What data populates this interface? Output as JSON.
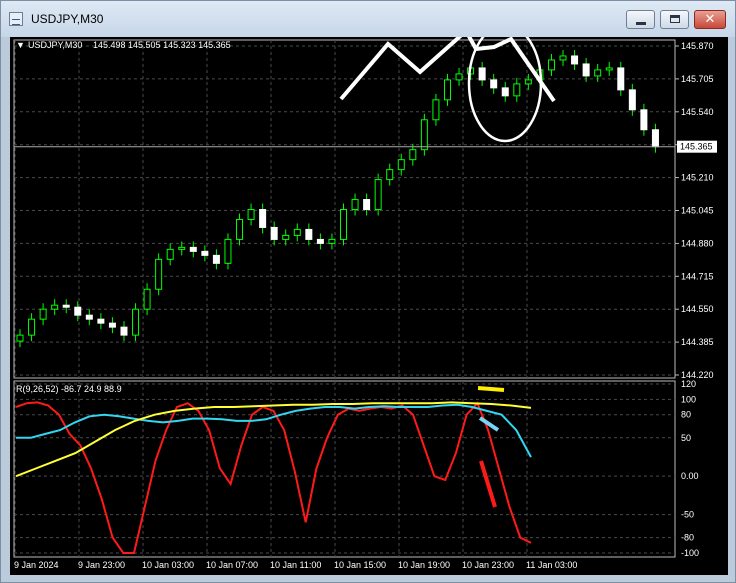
{
  "window": {
    "title": "USDJPY,M30",
    "buttons": {
      "minimize": "minimize",
      "maximize": "maximize",
      "close": "close"
    }
  },
  "chart": {
    "symbol_label": "USDJPY,M30",
    "ohlc_text": "145.498 145.505 145.323 145.365",
    "current_price": "145.365",
    "price_ticks": [
      "145.870",
      "145.705",
      "145.540",
      "145.365",
      "145.210",
      "145.045",
      "144.880",
      "144.715",
      "144.550",
      "144.385",
      "144.220"
    ],
    "time_ticks": [
      "9 Jan 2024",
      "9 Jan 23:00",
      "10 Jan 03:00",
      "10 Jan 07:00",
      "10 Jan 11:00",
      "10 Jan 15:00",
      "10 Jan 19:00",
      "10 Jan 23:00",
      "11 Jan 03:00"
    ],
    "indicator_label": "R(9,26,52) -86.7 24.9 88.9",
    "indicator_ticks": [
      "120",
      "100",
      "80",
      "50",
      "0.00",
      "-50",
      "-80",
      "-100"
    ],
    "colors": {
      "background": "#000000",
      "bull": "#00ff00",
      "fast": "#ff1a1a",
      "mid": "#33d6f0",
      "slow": "#ffff33",
      "grid": "#4a4a4a"
    }
  },
  "chart_data": {
    "type": "line",
    "price_pane": {
      "y_range": [
        144.22,
        145.87
      ],
      "close_approx": [
        144.42,
        144.5,
        144.55,
        144.57,
        144.56,
        144.52,
        144.5,
        144.48,
        144.46,
        144.42,
        144.55,
        144.65,
        144.8,
        144.85,
        144.86,
        144.84,
        144.82,
        144.78,
        144.9,
        145.0,
        145.05,
        144.96,
        144.9,
        144.92,
        144.95,
        144.9,
        144.88,
        144.9,
        145.05,
        145.1,
        145.05,
        145.2,
        145.25,
        145.3,
        145.35,
        145.5,
        145.6,
        145.7,
        145.73,
        145.76,
        145.7,
        145.66,
        145.62,
        145.68,
        145.7,
        145.75,
        145.8,
        145.82,
        145.78,
        145.72,
        145.75,
        145.76,
        145.65,
        145.55,
        145.45,
        145.365
      ]
    },
    "indicator_pane": {
      "y_range": [
        -100,
        120
      ],
      "series": [
        {
          "name": "fast",
          "values": [
            90,
            95,
            96,
            92,
            80,
            55,
            40,
            10,
            -30,
            -80,
            -100,
            -100,
            -40,
            20,
            60,
            90,
            95,
            85,
            60,
            10,
            -10,
            40,
            80,
            90,
            85,
            60,
            5,
            -60,
            10,
            50,
            80,
            88,
            85,
            88,
            90,
            88,
            92,
            80,
            40,
            0,
            -5,
            30,
            80,
            95,
            60,
            10,
            -40,
            -80,
            -86.7
          ]
        },
        {
          "name": "mid",
          "values": [
            50,
            50,
            55,
            60,
            70,
            78,
            80,
            78,
            75,
            72,
            70,
            72,
            75,
            75,
            74,
            72,
            72,
            74,
            80,
            85,
            88,
            90,
            90,
            88,
            90,
            91,
            90,
            90,
            90,
            92,
            93,
            90,
            85,
            80,
            60,
            24.9
          ]
        },
        {
          "name": "slow",
          "values": [
            0,
            10,
            20,
            30,
            45,
            60,
            72,
            80,
            85,
            88,
            90,
            90,
            91,
            92,
            93,
            93,
            94,
            94,
            95,
            95,
            95,
            95,
            96,
            95,
            94,
            92,
            88.9
          ]
        }
      ]
    }
  }
}
